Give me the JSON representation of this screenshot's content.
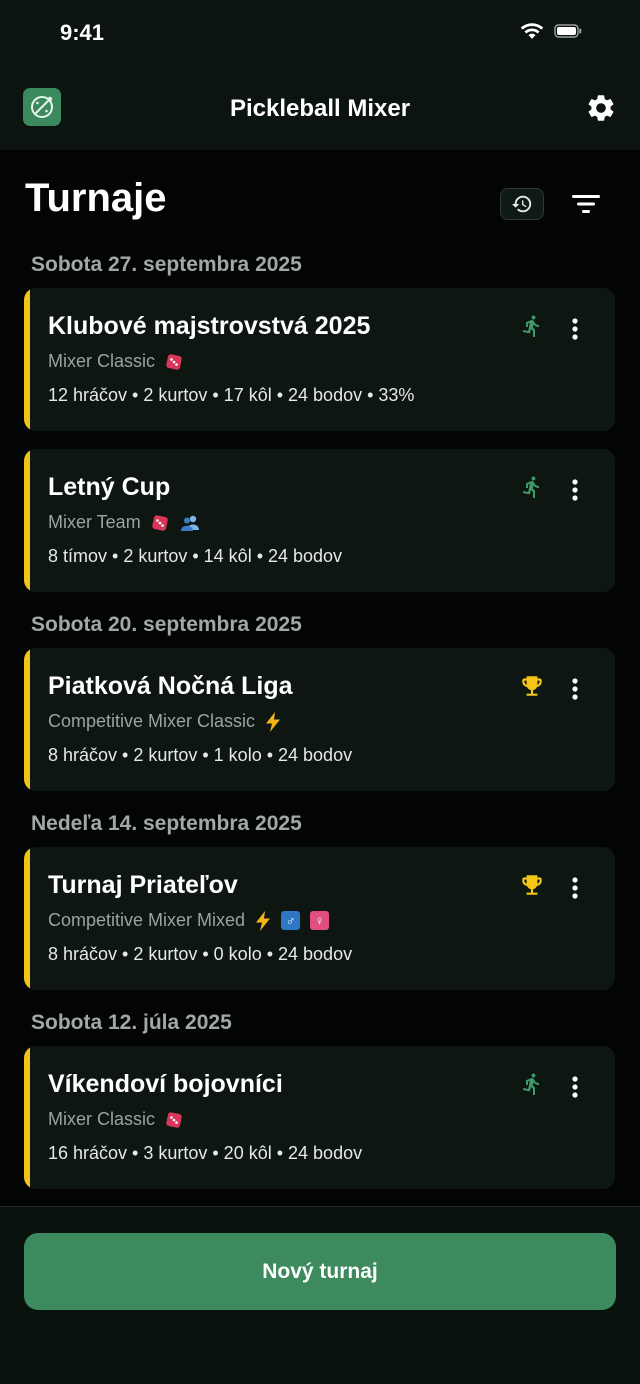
{
  "status_bar": {
    "time": "9:41"
  },
  "app_bar": {
    "title": "Pickleball Mixer"
  },
  "page": {
    "title": "Turnaje"
  },
  "groups": [
    {
      "date": "Sobota 27. septembra 2025"
    },
    {
      "date": "Sobota 20. septembra 2025"
    },
    {
      "date": "Nedeľa 14. septembra 2025"
    },
    {
      "date": "Sobota 12. júla 2025"
    }
  ],
  "tournaments": [
    {
      "name": "Klubové majstrovstvá 2025",
      "mode": "Mixer Classic",
      "meta": "12 hráčov  •  2 kurtov  •  17 kôl  •  24 bodov  •  33%",
      "status": "in-progress",
      "progress_percent": 33
    },
    {
      "name": "Letný Cup",
      "mode": "Mixer Team",
      "meta": "8 tímov  •  2 kurtov  •  14 kôl  •  24 bodov",
      "status": "in-progress"
    },
    {
      "name": "Piatková Nočná Liga",
      "mode": "Competitive Mixer Classic",
      "meta": "8 hráčov  •  2 kurtov  •  1 kolo  •  24 bodov",
      "status": "finished"
    },
    {
      "name": "Turnaj Priateľov",
      "mode": "Competitive Mixer Mixed",
      "meta": "8 hráčov  •  2 kurtov  •  0 kolo  •  24 bodov",
      "status": "finished"
    },
    {
      "name": "Víkendoví bojovníci",
      "mode": "Mixer Classic",
      "meta": "16 hráčov  •  3 kurtov  •  20 kôl  •  24 bodov",
      "status": "in-progress"
    }
  ],
  "badges": {
    "male": "♂",
    "female": "♀"
  },
  "icons": {
    "in_progress": "running-person-icon",
    "finished": "trophy-icon",
    "random": "dice-icon",
    "team": "people-icon",
    "competitive": "lightning-icon"
  },
  "colors": {
    "accent": "#3d8a5f",
    "card_stripe": "#f0c419",
    "trophy": "#f5c518",
    "running": "#3e9a66"
  },
  "actions": {
    "new_tournament": "Nový turnaj"
  }
}
